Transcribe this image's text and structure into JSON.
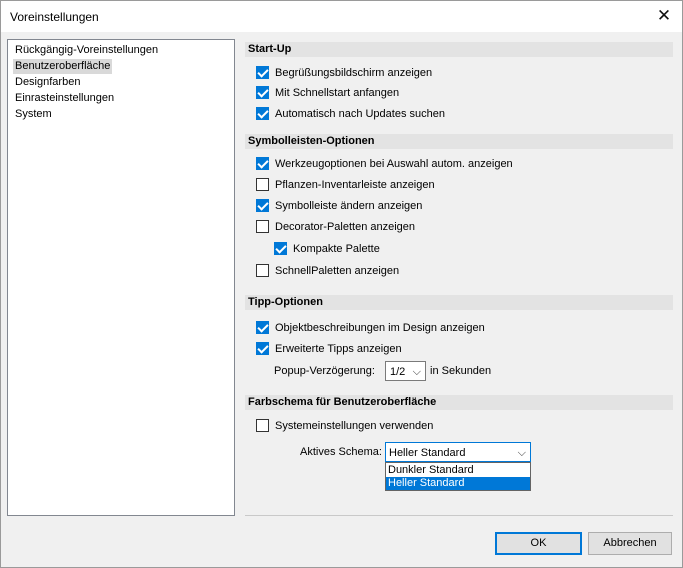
{
  "window": {
    "title": "Voreinstellungen",
    "close_glyph": "✕"
  },
  "nav": {
    "items": [
      {
        "label": "Rückgängig-Voreinstellungen",
        "selected": false
      },
      {
        "label": "Benutzeroberfläche",
        "selected": true
      },
      {
        "label": "Designfarben",
        "selected": false
      },
      {
        "label": "Einrasteinstellungen",
        "selected": false
      },
      {
        "label": "System",
        "selected": false
      }
    ]
  },
  "sections": {
    "startup": "Start-Up",
    "toolbar": "Symbolleisten-Optionen",
    "tips": "Tipp-Optionen",
    "colorscheme": "Farbschema für Benutzeroberfläche"
  },
  "checkboxes": {
    "welcome": {
      "label": "Begrüßungsbildschirm anzeigen",
      "checked": true
    },
    "quickstart": {
      "label": "Mit Schnellstart anfangen",
      "checked": true
    },
    "updates": {
      "label": "Automatisch nach Updates suchen",
      "checked": true
    },
    "tooloptions": {
      "label": "Werkzeugoptionen bei Auswahl autom. anzeigen",
      "checked": true
    },
    "plants": {
      "label": "Pflanzen-Inventarleiste anzeigen",
      "checked": false
    },
    "changebar": {
      "label": "Symbolleiste ändern anzeigen",
      "checked": true
    },
    "decorator": {
      "label": "Decorator-Paletten anzeigen",
      "checked": false
    },
    "compact": {
      "label": "Kompakte Palette",
      "checked": true
    },
    "quickpalettes": {
      "label": "SchnellPaletten anzeigen",
      "checked": false
    },
    "objdesc": {
      "label": "Objektbeschreibungen im Design anzeigen",
      "checked": true
    },
    "advtips": {
      "label": "Erweiterte Tipps anzeigen",
      "checked": true
    },
    "sysset": {
      "label": "Systemeinstellungen verwenden",
      "checked": false
    }
  },
  "popup": {
    "label": "Popup-Verzögerung:",
    "value": "1/2",
    "suffix": "in Sekunden"
  },
  "scheme": {
    "label": "Aktives Schema:",
    "value": "Heller Standard",
    "options": [
      "Dunkler Standard",
      "Heller Standard"
    ],
    "highlighted_index": 1
  },
  "buttons": {
    "ok": "OK",
    "cancel": "Abbrechen"
  },
  "colors": {
    "accent": "#0078d7",
    "section_bg": "#e3e3e3",
    "dialog_bg": "#f0f0f0"
  }
}
